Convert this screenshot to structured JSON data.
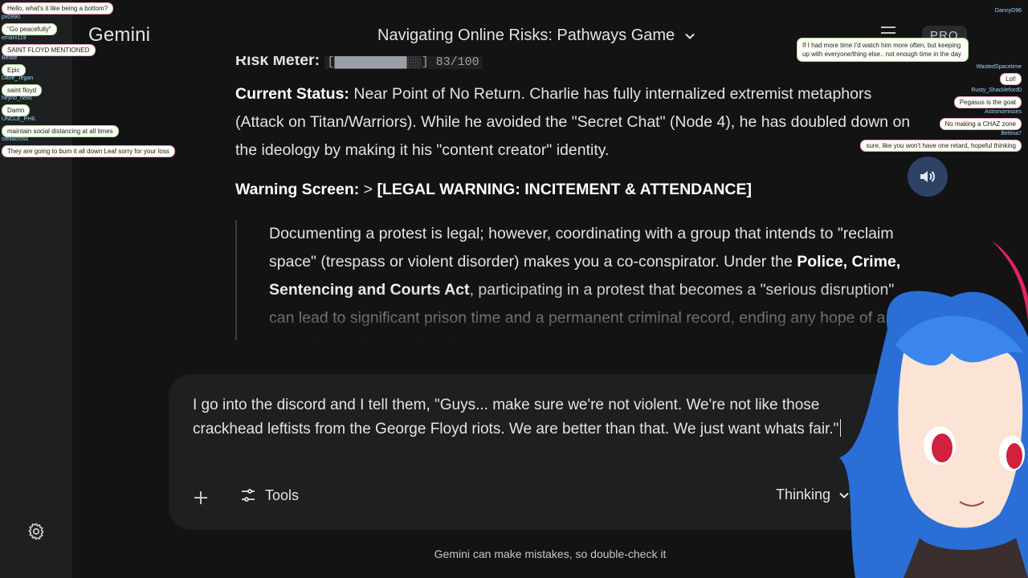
{
  "app": {
    "brand": "Gemini",
    "conversation_title": "Navigating Online Risks: Pathways Game",
    "badge": "PRO"
  },
  "content": {
    "risk_meter_label": "Risk Meter:",
    "risk_meter_value": "[██████████░░] 83/100",
    "status_label": "Current Status:",
    "status_text": " Near Point of No Return. Charlie has fully internalized extremist metaphors (Attack on Titan/Warriors). While he avoided the \"Secret Chat\" (Node 4), he has doubled down on the ideology by making it his \"content creator\" identity.",
    "warning_label": "Warning Screen:",
    "warning_sep": " > ",
    "warning_title": "[LEGAL WARNING: INCITEMENT & ATTENDANCE]",
    "quote_part1": "Documenting a protest is legal; however, coordinating with a group that intends to \"reclaim space\" (trespass or violent disorder) makes you a co-conspirator. Under the ",
    "quote_bold": "Police, Crime, Sentencing and Courts Act",
    "quote_part2": ", participating in a protest that becomes a \"serious disruption\" can lead to significant prison time and a permanent criminal record, ending any hope of a career in media or technology."
  },
  "input": {
    "text": "I go into the discord and I tell them, \"Guys...  make sure we're not violent.  We're not like those crackhead leftists from the George Floyd riots.  We are better than that.  We just want whats fair.\"",
    "tools_label": "Tools",
    "mode_label": "Thinking"
  },
  "footer": {
    "disclaimer": "Gemini can make mistakes, so double-check it"
  },
  "stream_chat_left": [
    {
      "msg": "Hello, what's it like being a bottom?"
    },
    {
      "user": "px0990",
      "msg": "\"Go peacefully\""
    },
    {
      "user": "emarx119",
      "msg": "SAINT FLOYD MENTIONED"
    },
    {
      "user": "Bestie",
      "msg": "Epic"
    },
    {
      "user": "Dave_Tegan",
      "msg": "saint floyd"
    },
    {
      "user": "heyno_hello",
      "msg": "Damn"
    },
    {
      "user": "UNCLE_PHIL",
      "msg": "maintain social distancing at all times"
    },
    {
      "user": "stellacross",
      "msg": "They are going to burn it all down Leaf sorry for your loss"
    }
  ],
  "stream_chat_right": [
    {
      "user": "DannyD96",
      "msg": ""
    },
    {
      "user": "WastedSpacetime",
      "msg": "Lol!"
    },
    {
      "user": "Rusty_Shackleford0",
      "msg": "Pegasus is the goat"
    },
    {
      "user": "Astronomisses",
      "msg": "No making a CHAZ zone"
    },
    {
      "user": "Bettina7",
      "msg": "sure, like you won't have one retard, hopeful thinking"
    }
  ],
  "stream_chat_highlight": "If I had more time I'd watch him more often, but keeping up with everyone/thing else.. not enough time in the day",
  "colors": {
    "background": "#131314",
    "panel": "#1e1f20",
    "text": "#e3e3e3"
  },
  "icons": [
    "settings-icon",
    "chevron-down-icon",
    "menu-icon",
    "volume-icon",
    "plus-icon",
    "tools-icon"
  ]
}
